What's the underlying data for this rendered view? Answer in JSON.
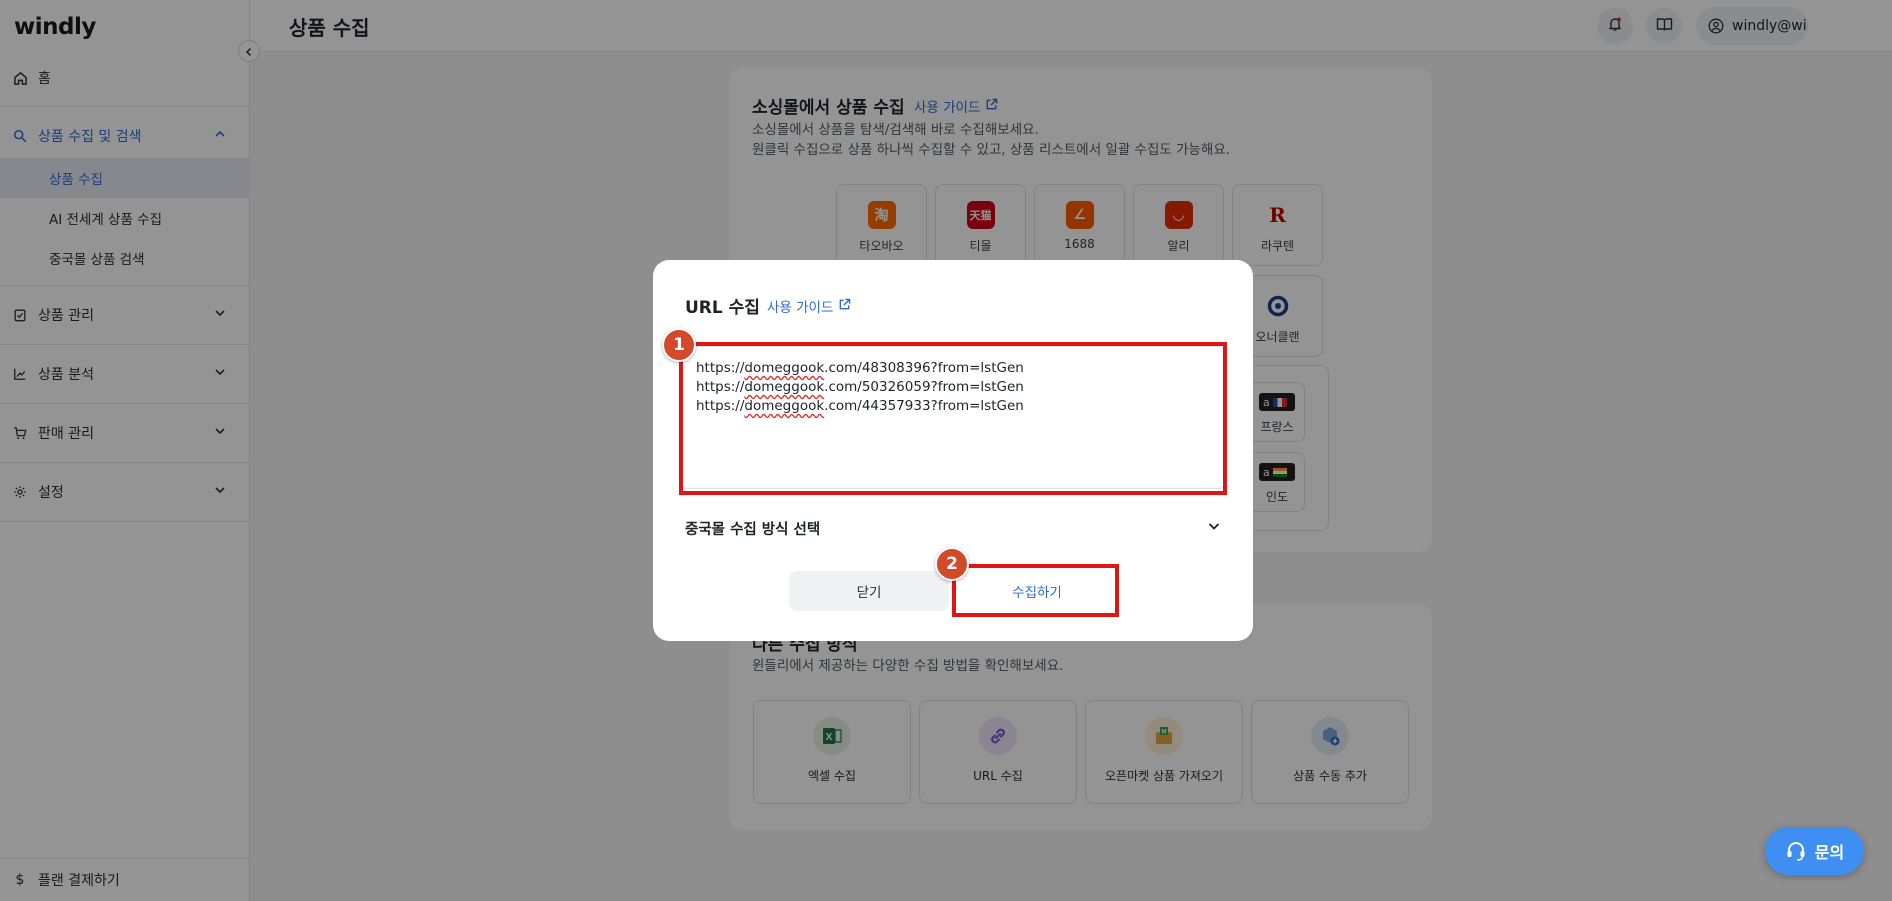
{
  "app": {
    "logo": "windly"
  },
  "sidebar": {
    "home": "홈",
    "collect_group": "상품 수집 및 검색",
    "sub_items": [
      "상품 수집",
      "AI 전세계 상품 수집",
      "중국몰 상품 검색"
    ],
    "manage": "상품 관리",
    "analysis": "상품 분석",
    "sales": "판매 관리",
    "settings": "설정",
    "plan": "플랜 결제하기"
  },
  "header": {
    "title": "상품 수집",
    "user_email": "windly@windly.cc"
  },
  "social_card": {
    "title": "소싱몰에서 상품 수집",
    "guide": "사용 가이드",
    "desc_line1": "소싱몰에서 상품을 탐색/검색해 바로 수집해보세요.",
    "desc_line2": "원클릭 수집으로 상품 하나씩 수집할 수 있고, 상품 리스트에서 일괄 수집도 가능해요.",
    "malls": [
      "타오바오",
      "티몰",
      "1688",
      "알리",
      "라쿠텐"
    ],
    "mall_extra": "오너클랜",
    "amazon_regions": [
      "프랑스",
      "인도"
    ]
  },
  "other_card": {
    "title": "다른 수집 방식",
    "desc": "윈들리에서 제공하는 다양한 수집 방법을 확인해보세요.",
    "methods": [
      "엑셀 수집",
      "URL 수집",
      "오픈마켓 상품 가져오기",
      "상품 수동 추가"
    ]
  },
  "modal": {
    "title": "URL 수집",
    "guide": "사용 가이드",
    "urls": [
      {
        "domain": "domeggook",
        "full": "https://domeggook.com/48308396?from=lstGen"
      },
      {
        "domain": "domeggook",
        "full": "https://domeggook.com/50326059?from=lstGen"
      },
      {
        "domain": "domeggook",
        "full": "https://domeggook.com/44357933?from=lstGen"
      }
    ],
    "url_lines": {
      "l1_pre": "https://",
      "l1_dom": "domeggook",
      "l1_post": ".com/48308396?from=lstGen",
      "l2_pre": "https://",
      "l2_dom": "domeggook",
      "l2_post": ".com/50326059?from=lstGen",
      "l3_pre": "https://",
      "l3_dom": "domeggook",
      "l3_post": ".com/44357933?from=lstGen"
    },
    "china_method": "중국몰 수집 방식 선택",
    "close_btn": "닫기",
    "collect_btn": "수집하기"
  },
  "annotations": {
    "step1": "1",
    "step2": "2"
  },
  "chat": {
    "label": "문의"
  },
  "colors": {
    "accent": "#2f6bd3",
    "highlight": "#e01616",
    "badge": "#d24a2a",
    "chat": "#3f8ef2"
  }
}
